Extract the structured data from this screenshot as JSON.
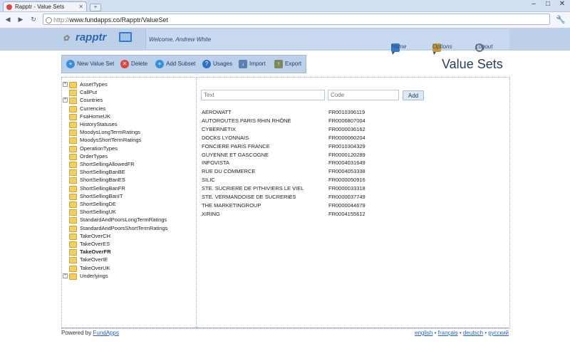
{
  "browser": {
    "tab_title": "Rapptr - Value Sets",
    "new_tab": "+",
    "url_proto": "http://",
    "url_rest": "www.fundapps.co/Rapptr/ValueSet",
    "minimize": "–",
    "maximize": "□",
    "close": "✕"
  },
  "app": {
    "logo_text": "rapptr",
    "welcome": "Welcome, Andrew White",
    "menu": {
      "home": "Home ▾",
      "options": "Options ▾",
      "logout": "Logout"
    }
  },
  "toolbar": {
    "new_value_set": "New Value Set",
    "delete": "Delete",
    "add_subset": "Add Subset",
    "usages": "Usages",
    "import": "Import",
    "export": "Export"
  },
  "page_title": "Value Sets",
  "tree": [
    {
      "label": "AssetTypes",
      "expandable": true
    },
    {
      "label": "CallPut",
      "expandable": false
    },
    {
      "label": "Countries",
      "expandable": true
    },
    {
      "label": "Currencies",
      "expandable": false
    },
    {
      "label": "FsaHomeUK",
      "expandable": false
    },
    {
      "label": "HistoryStatuses",
      "expandable": false
    },
    {
      "label": "MoodysLongTermRatings",
      "expandable": false
    },
    {
      "label": "MoodysShortTermRatings",
      "expandable": false
    },
    {
      "label": "OperationTypes",
      "expandable": false
    },
    {
      "label": "OrderTypes",
      "expandable": false
    },
    {
      "label": "ShortSellingAllowedFR",
      "expandable": false
    },
    {
      "label": "ShortSellingBanBE",
      "expandable": false
    },
    {
      "label": "ShortSellingBanES",
      "expandable": false
    },
    {
      "label": "ShortSellingBanFR",
      "expandable": false
    },
    {
      "label": "ShortSellingBanIT",
      "expandable": false
    },
    {
      "label": "ShortSellingDE",
      "expandable": false
    },
    {
      "label": "ShortSellingUK",
      "expandable": false
    },
    {
      "label": "StandardAndPoorsLongTermRatings",
      "expandable": false
    },
    {
      "label": "StandardAndPoorsShortTermRatings",
      "expandable": false
    },
    {
      "label": "TakeOverCH",
      "expandable": false
    },
    {
      "label": "TakeOverES",
      "expandable": false
    },
    {
      "label": "TakeOverFR",
      "expandable": false,
      "selected": true
    },
    {
      "label": "TakeOverIE",
      "expandable": false
    },
    {
      "label": "TakeOverUK",
      "expandable": false
    },
    {
      "label": "Underlyings",
      "expandable": true
    }
  ],
  "form": {
    "text_placeholder": "Text",
    "code_placeholder": "Code",
    "add_label": "Add"
  },
  "values": [
    {
      "text": "AEROWATT",
      "code": "FR0010396119"
    },
    {
      "text": "AUTOROUTES PARIS RHIN RHÔNE",
      "code": "FR0006807004"
    },
    {
      "text": "CYBERNETIX",
      "code": "FR0000036162"
    },
    {
      "text": "DOCKS LYONNAIS",
      "code": "FR0000060204"
    },
    {
      "text": "FONCIERE PARIS FRANCE",
      "code": "FR0010304329"
    },
    {
      "text": "GUYENNE ET GASCOGNE",
      "code": "FR0000120289"
    },
    {
      "text": "INFOVISTA",
      "code": "FR0004031649"
    },
    {
      "text": "RUE DU COMMERCE",
      "code": "FR0004053338"
    },
    {
      "text": "SILIC",
      "code": "FR0000050916"
    },
    {
      "text": "STE. SUCRIERE DE PITHIVIERS LE VIEL",
      "code": "FR0000033318"
    },
    {
      "text": "STE. VERMANDOISE DE SUCRERIES",
      "code": "FR0000037749"
    },
    {
      "text": "THE MARKETINGROUP",
      "code": "FR0000044679"
    },
    {
      "text": "XIRING",
      "code": "FR0004155612"
    }
  ],
  "footer": {
    "powered_by": "Powered by",
    "fundapps": "FundApps",
    "lang_en": "english",
    "lang_fr": "français",
    "lang_de": "deutsch",
    "lang_ru": "русский",
    "sep": "•"
  }
}
